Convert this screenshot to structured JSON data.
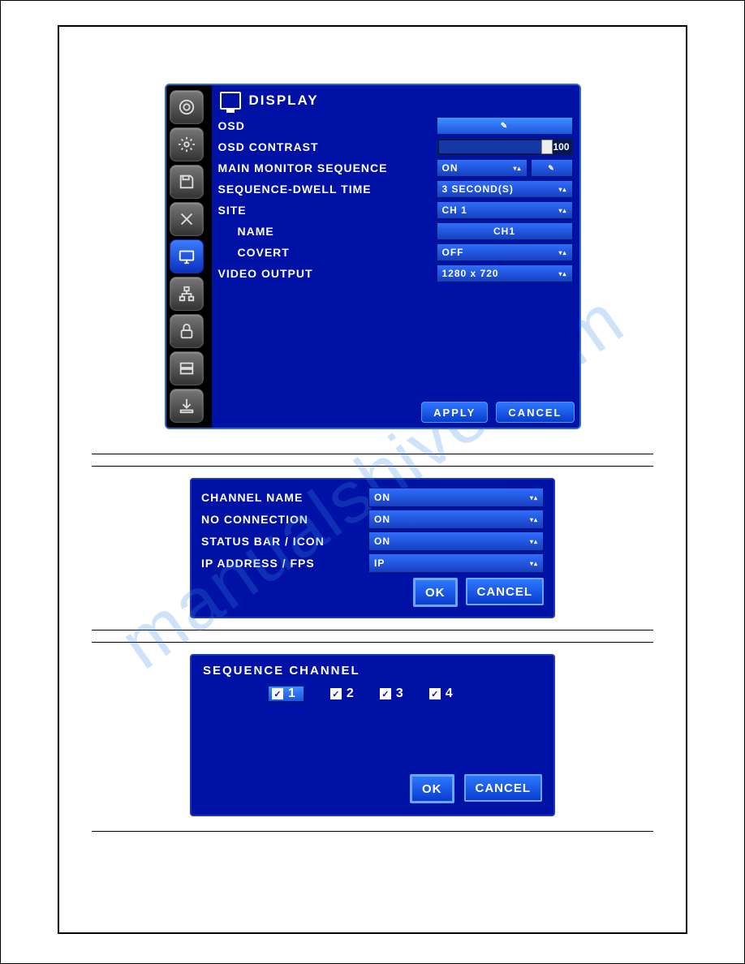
{
  "panel1": {
    "title": "DISPLAY",
    "rows": {
      "osd": "OSD",
      "osd_contrast": "OSD CONTRAST",
      "contrast_value": "100",
      "main_seq": "MAIN MONITOR SEQUENCE",
      "main_seq_val": "ON",
      "dwell": "SEQUENCE-DWELL TIME",
      "dwell_val": "3 SECOND(S)",
      "site": "SITE",
      "site_val": "CH 1",
      "name": "NAME",
      "name_val": "CH1",
      "covert": "COVERT",
      "covert_val": "OFF",
      "video_out": "VIDEO OUTPUT",
      "video_out_val": "1280 x 720"
    },
    "buttons": {
      "apply": "APPLY",
      "cancel": "CANCEL"
    }
  },
  "panel2": {
    "rows": {
      "chname": "CHANNEL NAME",
      "chname_val": "ON",
      "noconn": "NO CONNECTION",
      "noconn_val": "ON",
      "status": "STATUS BAR / ICON",
      "status_val": "ON",
      "ipfps": "IP ADDRESS / FPS",
      "ipfps_val": "IP"
    },
    "buttons": {
      "ok": "OK",
      "cancel": "CANCEL"
    }
  },
  "panel3": {
    "title": "SEQUENCE CHANNEL",
    "channels": [
      "1",
      "2",
      "3",
      "4"
    ],
    "buttons": {
      "ok": "OK",
      "cancel": "CANCEL"
    }
  },
  "watermark": "manualshive.com",
  "sidebar_icons": [
    "camera",
    "settings",
    "save",
    "tools",
    "display",
    "network",
    "lock",
    "drive",
    "download"
  ]
}
